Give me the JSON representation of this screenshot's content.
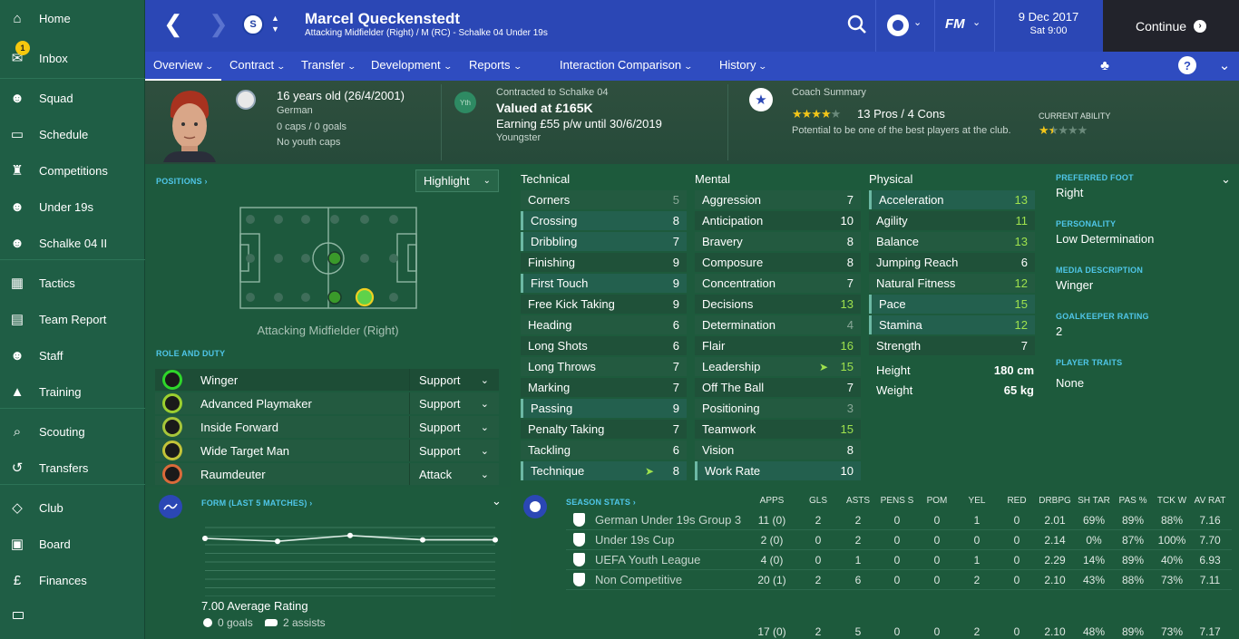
{
  "sidebar": {
    "items": [
      {
        "label": "Home",
        "icon": "home-icon"
      },
      {
        "label": "Inbox",
        "icon": "inbox-icon",
        "badge": "1"
      },
      {
        "label": "Squad",
        "icon": "squad-icon"
      },
      {
        "label": "Schedule",
        "icon": "schedule-icon"
      },
      {
        "label": "Competitions",
        "icon": "trophy-icon"
      },
      {
        "label": "Under 19s",
        "icon": "under19-icon"
      },
      {
        "label": "Schalke 04 II",
        "icon": "reserve-icon"
      },
      {
        "label": "Tactics",
        "icon": "tactics-icon"
      },
      {
        "label": "Team Report",
        "icon": "report-icon"
      },
      {
        "label": "Staff",
        "icon": "staff-icon"
      },
      {
        "label": "Training",
        "icon": "training-icon"
      },
      {
        "label": "Scouting",
        "icon": "scouting-icon"
      },
      {
        "label": "Transfers",
        "icon": "transfers-icon"
      },
      {
        "label": "Club",
        "icon": "club-icon"
      },
      {
        "label": "Board",
        "icon": "board-icon"
      },
      {
        "label": "Finances",
        "icon": "finances-icon"
      }
    ]
  },
  "header": {
    "player_name": "Marcel Queckenstedt",
    "player_subtitle": "Attacking Midfielder (Right) / M (RC) - Schalke 04 Under 19s",
    "date": "9 Dec 2017",
    "time": "Sat 9:00",
    "continue_label": "Continue",
    "fm_label": "FM"
  },
  "nav": [
    "Overview",
    "Contract",
    "Transfer",
    "Development",
    "Reports",
    "Interaction",
    "Comparison",
    "History"
  ],
  "profile": {
    "age": "16 years old (26/4/2001)",
    "nationality": "German",
    "caps": "0 caps / 0 goals",
    "youth_caps": "No youth caps",
    "yth_badge": "Yth",
    "contract": "Contracted to Schalke 04",
    "value": "Valued at £165K",
    "earning": "Earning £55 p/w until 30/6/2019",
    "status": "Youngster",
    "coach_title": "Coach Summary",
    "pros_cons": "13 Pros / 4 Cons",
    "potential": "Potential to be one of the best players at the club.",
    "current_ability_label": "CURRENT ABILITY",
    "coach_stars": 4,
    "ability_stars": 1.5
  },
  "positions": {
    "title": "POSITIONS",
    "highlight": "Highlight",
    "position_label": "Attacking Midfielder (Right)",
    "role_title": "ROLE AND DUTY",
    "roles": [
      {
        "role": "Winger",
        "duty": "Support"
      },
      {
        "role": "Advanced Playmaker",
        "duty": "Support"
      },
      {
        "role": "Inside Forward",
        "duty": "Support"
      },
      {
        "role": "Wide Target Man",
        "duty": "Support"
      },
      {
        "role": "Raumdeuter",
        "duty": "Attack"
      }
    ]
  },
  "attributes": {
    "technical_title": "Technical",
    "mental_title": "Mental",
    "physical_title": "Physical",
    "technical": [
      {
        "name": "Corners",
        "value": "5"
      },
      {
        "name": "Crossing",
        "value": "8"
      },
      {
        "name": "Dribbling",
        "value": "7"
      },
      {
        "name": "Finishing",
        "value": "9"
      },
      {
        "name": "First Touch",
        "value": "9"
      },
      {
        "name": "Free Kick Taking",
        "value": "9"
      },
      {
        "name": "Heading",
        "value": "6"
      },
      {
        "name": "Long Shots",
        "value": "6"
      },
      {
        "name": "Long Throws",
        "value": "7"
      },
      {
        "name": "Marking",
        "value": "7"
      },
      {
        "name": "Passing",
        "value": "9"
      },
      {
        "name": "Penalty Taking",
        "value": "7"
      },
      {
        "name": "Tackling",
        "value": "6"
      },
      {
        "name": "Technique",
        "value": "8"
      }
    ],
    "mental": [
      {
        "name": "Aggression",
        "value": "7"
      },
      {
        "name": "Anticipation",
        "value": "10"
      },
      {
        "name": "Bravery",
        "value": "8"
      },
      {
        "name": "Composure",
        "value": "8"
      },
      {
        "name": "Concentration",
        "value": "7"
      },
      {
        "name": "Decisions",
        "value": "13"
      },
      {
        "name": "Determination",
        "value": "4"
      },
      {
        "name": "Flair",
        "value": "16"
      },
      {
        "name": "Leadership",
        "value": "15"
      },
      {
        "name": "Off The Ball",
        "value": "7"
      },
      {
        "name": "Positioning",
        "value": "3"
      },
      {
        "name": "Teamwork",
        "value": "15"
      },
      {
        "name": "Vision",
        "value": "8"
      },
      {
        "name": "Work Rate",
        "value": "10"
      }
    ],
    "physical": [
      {
        "name": "Acceleration",
        "value": "13"
      },
      {
        "name": "Agility",
        "value": "11"
      },
      {
        "name": "Balance",
        "value": "13"
      },
      {
        "name": "Jumping Reach",
        "value": "6"
      },
      {
        "name": "Natural Fitness",
        "value": "12"
      },
      {
        "name": "Pace",
        "value": "15"
      },
      {
        "name": "Stamina",
        "value": "12"
      },
      {
        "name": "Strength",
        "value": "7"
      }
    ],
    "height_label": "Height",
    "height": "180 cm",
    "weight_label": "Weight",
    "weight": "65 kg"
  },
  "info": {
    "preferred_foot_label": "PREFERRED FOOT",
    "preferred_foot": "Right",
    "personality_label": "PERSONALITY",
    "personality": "Low Determination",
    "media_label": "MEDIA DESCRIPTION",
    "media": "Winger",
    "gk_label": "GOALKEEPER RATING",
    "gk": "2",
    "traits_label": "PLAYER TRAITS",
    "traits": "None"
  },
  "form": {
    "title": "FORM (LAST 5 MATCHES)",
    "average": "7.00 Average Rating",
    "goals": "0 goals",
    "assists": "2 assists",
    "values": [
      7.0,
      6.98,
      7.02,
      6.99,
      6.99
    ]
  },
  "season": {
    "title": "SEASON STATS",
    "columns": [
      "APPS",
      "GLS",
      "ASTS",
      "PENS S",
      "POM",
      "YEL",
      "RED",
      "DRBPG",
      "SH TAR",
      "PAS %",
      "TCK W",
      "AV RAT"
    ],
    "rows": [
      {
        "comp": "German Under 19s Group 3",
        "cells": [
          "11 (0)",
          "2",
          "2",
          "0",
          "0",
          "1",
          "0",
          "2.01",
          "69%",
          "89%",
          "88%",
          "7.16"
        ]
      },
      {
        "comp": "Under 19s Cup",
        "cells": [
          "2 (0)",
          "0",
          "2",
          "0",
          "0",
          "0",
          "0",
          "2.14",
          "0%",
          "87%",
          "100%",
          "7.70"
        ]
      },
      {
        "comp": "UEFA Youth League",
        "cells": [
          "4 (0)",
          "0",
          "1",
          "0",
          "0",
          "1",
          "0",
          "2.29",
          "14%",
          "89%",
          "40%",
          "6.93"
        ]
      },
      {
        "comp": "Non Competitive",
        "cells": [
          "20 (1)",
          "2",
          "6",
          "0",
          "0",
          "2",
          "0",
          "2.10",
          "43%",
          "88%",
          "73%",
          "7.11"
        ]
      }
    ],
    "total": [
      "17 (0)",
      "2",
      "5",
      "0",
      "0",
      "2",
      "0",
      "2.10",
      "48%",
      "89%",
      "73%",
      "7.17"
    ]
  },
  "colors": {
    "green_value": "#9fe24d",
    "accent_blue": "#4fc6e8",
    "topbar": "#2b47b5"
  }
}
